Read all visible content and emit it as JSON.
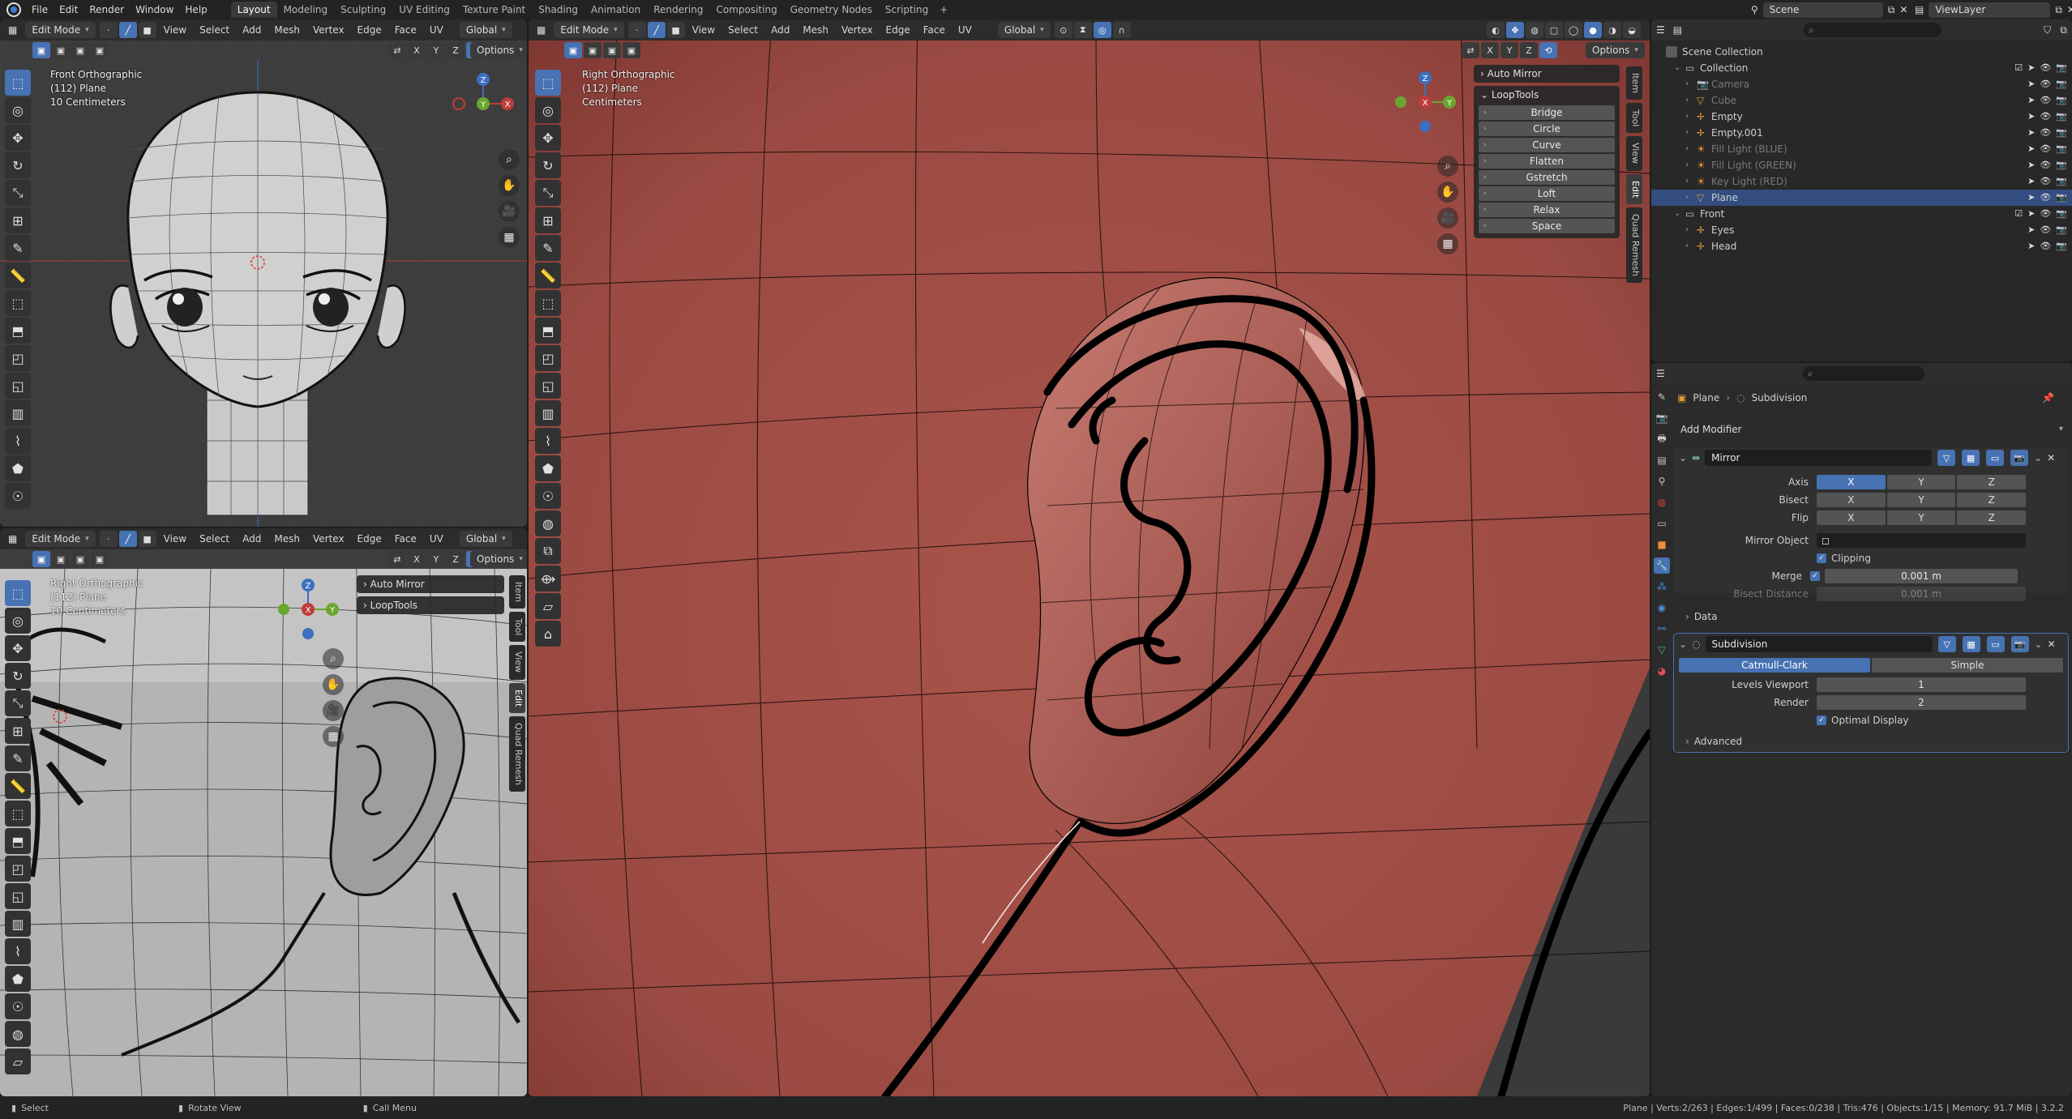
{
  "menu": {
    "items": [
      "File",
      "Edit",
      "Render",
      "Window",
      "Help"
    ],
    "workspaces": [
      "Layout",
      "Modeling",
      "Sculpting",
      "UV Editing",
      "Texture Paint",
      "Shading",
      "Animation",
      "Rendering",
      "Compositing",
      "Geometry Nodes",
      "Scripting"
    ],
    "active_workspace": "Layout",
    "scene": "Scene",
    "view_layer": "ViewLayer"
  },
  "viewport_header": {
    "mode": "Edit Mode",
    "menus": [
      "View",
      "Select",
      "Add",
      "Mesh",
      "Vertex",
      "Edge",
      "Face",
      "UV"
    ],
    "orientation": "Global",
    "options": "Options",
    "axes": [
      "X",
      "Y",
      "Z"
    ]
  },
  "viewport_tl": {
    "info": [
      "Front Orthographic",
      "(112) Plane",
      "10 Centimeters"
    ]
  },
  "viewport_bl": {
    "info": [
      "Right Orthographic",
      "(112) Plane",
      "10 Centimeters"
    ],
    "panels": [
      "Auto Mirror",
      "LoopTools"
    ]
  },
  "viewport_main": {
    "info": [
      "Right Orthographic",
      "(112) Plane",
      "Centimeters"
    ],
    "auto_mirror": "Auto Mirror",
    "looptools_title": "LoopTools",
    "looptools_buttons": [
      "Bridge",
      "Circle",
      "Curve",
      "Flatten",
      "Gstretch",
      "Loft",
      "Relax",
      "Space"
    ]
  },
  "sidebar_tabs": [
    "Item",
    "Tool",
    "View",
    "Edit",
    "Quad Remesh"
  ],
  "outliner": {
    "root": "Scene Collection",
    "rows": [
      {
        "label": "Collection",
        "depth": 1,
        "kind": "collection"
      },
      {
        "label": "Camera",
        "depth": 2,
        "kind": "camera",
        "dim": true
      },
      {
        "label": "Cube",
        "depth": 2,
        "kind": "mesh",
        "dim": true
      },
      {
        "label": "Empty",
        "depth": 2,
        "kind": "empty",
        "dim": false
      },
      {
        "label": "Empty.001",
        "depth": 2,
        "kind": "empty",
        "dim": false
      },
      {
        "label": "Fill Light (BLUE)",
        "depth": 2,
        "kind": "light",
        "dim": true
      },
      {
        "label": "Fill Light (GREEN)",
        "depth": 2,
        "kind": "light",
        "dim": true
      },
      {
        "label": "Key Light (RED)",
        "depth": 2,
        "kind": "light",
        "dim": true
      },
      {
        "label": "Plane",
        "depth": 2,
        "kind": "mesh",
        "dim": false,
        "selected": true
      },
      {
        "label": "Front",
        "depth": 1,
        "kind": "collection"
      },
      {
        "label": "Eyes",
        "depth": 2,
        "kind": "empty",
        "dim": false
      },
      {
        "label": "Head",
        "depth": 2,
        "kind": "empty",
        "dim": false
      }
    ]
  },
  "properties": {
    "breadcrumb_object": "Plane",
    "breadcrumb_modifier": "Subdivision",
    "add_modifier": "Add Modifier",
    "mirror": {
      "name": "Mirror",
      "axis_label": "Axis",
      "bisect_label": "Bisect",
      "flip_label": "Flip",
      "axis_active": "X",
      "mirror_object_label": "Mirror Object",
      "clipping_label": "Clipping",
      "merge_label": "Merge",
      "merge_value": "0.001 m",
      "bisect_distance_label": "Bisect Distance",
      "bisect_distance_value": "0.001 m",
      "data_label": "Data"
    },
    "subdivision": {
      "name": "Subdivision",
      "modes": [
        "Catmull-Clark",
        "Simple"
      ],
      "levels_label": "Levels Viewport",
      "levels_value": "1",
      "render_label": "Render",
      "render_value": "2",
      "optimal_label": "Optimal Display",
      "advanced_label": "Advanced"
    }
  },
  "statusbar": {
    "select": "Select",
    "rotate": "Rotate View",
    "call_menu": "Call Menu",
    "stats": "Plane | Verts:2/263 | Edges:1/499 | Faces:0/238 | Tris:476 | Objects:1/15 | Memory: 91.7 MiB | 3.2.2"
  },
  "colors": {
    "accent": "#4772b3",
    "skin": "#a8524a",
    "clay": "#c8c8c8"
  }
}
